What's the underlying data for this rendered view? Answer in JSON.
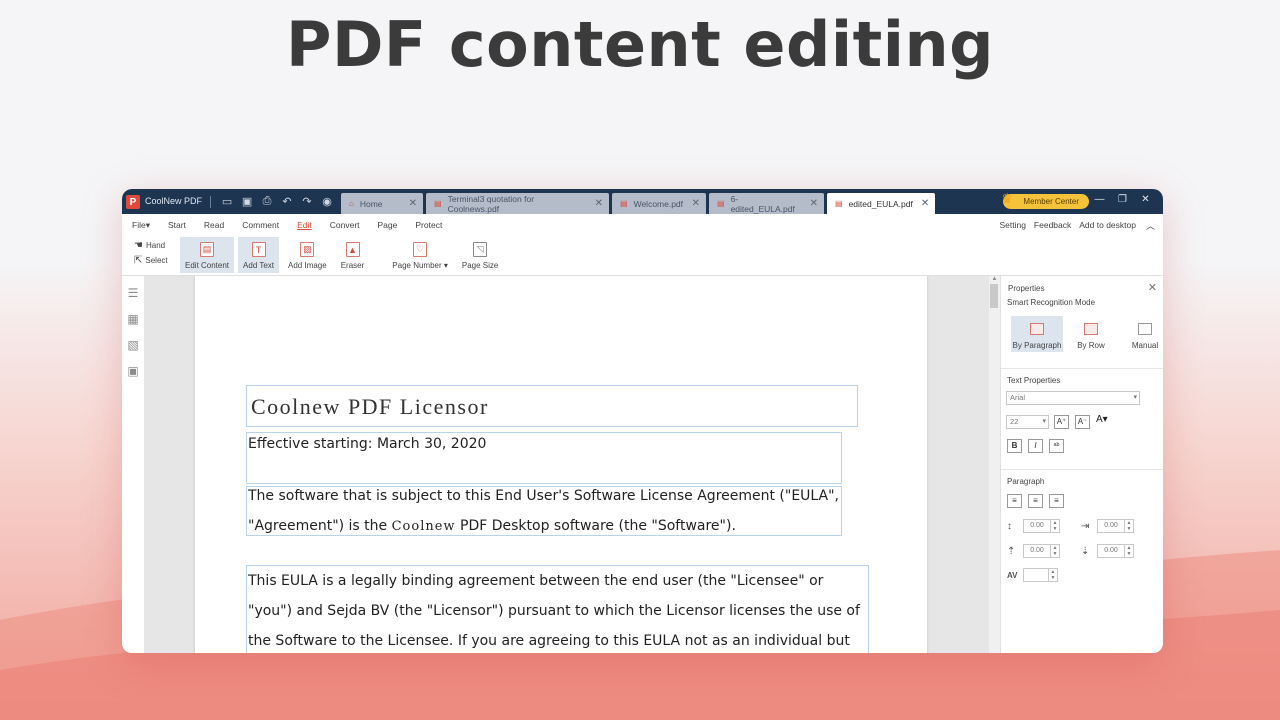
{
  "headline": "PDF content editing",
  "app": {
    "logo_letter": "P",
    "name": "CoolNew PDF",
    "quick_icons": [
      "folder-open-icon",
      "save-icon",
      "print-icon",
      "undo-icon",
      "redo-icon",
      "pin-icon"
    ],
    "tabs": [
      {
        "label": "Home",
        "active": false
      },
      {
        "label": "Terminal3 quotation for Coolnews.pdf",
        "active": false
      },
      {
        "label": "Welcome.pdf",
        "active": false
      },
      {
        "label": "6-edited_EULA.pdf",
        "active": false
      },
      {
        "label": "edited_EULA.pdf",
        "active": true
      }
    ],
    "member_center": "Member Center"
  },
  "menu": {
    "items": [
      "File▾",
      "Start",
      "Read",
      "Comment",
      "Edit",
      "Convert",
      "Page",
      "Protect"
    ],
    "active": "Edit",
    "right": [
      "Setting",
      "Feedback",
      "Add to desktop"
    ]
  },
  "ribbon": {
    "hand": "Hand",
    "select": "Select",
    "buttons": [
      {
        "label": "Edit Content",
        "selected": true
      },
      {
        "label": "Add Text",
        "selected": true
      },
      {
        "label": "Add Image",
        "selected": false
      },
      {
        "label": "Eraser",
        "selected": false
      },
      {
        "label": "Page Number ▾",
        "selected": false
      },
      {
        "label": "Page Size",
        "selected": false
      }
    ]
  },
  "document": {
    "title": "Coolnew PDF Licensor",
    "effective": "Effective starting: March 30, 2020",
    "para1_line1": "The software that is subject to this End User's Software License Agreement (\"EULA\",",
    "para1_line2_a": "\"Agreement\") is the ",
    "para1_line2_mono": "Coolnew",
    "para1_line2_b": " PDF Desktop software (the \"Software\").",
    "para2_lines": [
      "This EULA is a legally binding agreement between the end user (the \"Licensee\" or",
      "\"you\") and Sejda BV (the \"Licensor\") pursuant to which the Licensor licenses the use of",
      "the Software to the Licensee. If you are agreeing to this EULA not as an individual but"
    ]
  },
  "properties": {
    "title": "Properties",
    "smart_mode_label": "Smart Recognition Mode",
    "modes": [
      "By Paragraph",
      "By Row",
      "Manual"
    ],
    "selected_mode": "By Paragraph",
    "text_properties_label": "Text Properties",
    "font": "Arial",
    "size": "22",
    "paragraph_label": "Paragraph",
    "spacing_values": [
      "0.00",
      "0.00",
      "0.00",
      "0.00"
    ]
  }
}
